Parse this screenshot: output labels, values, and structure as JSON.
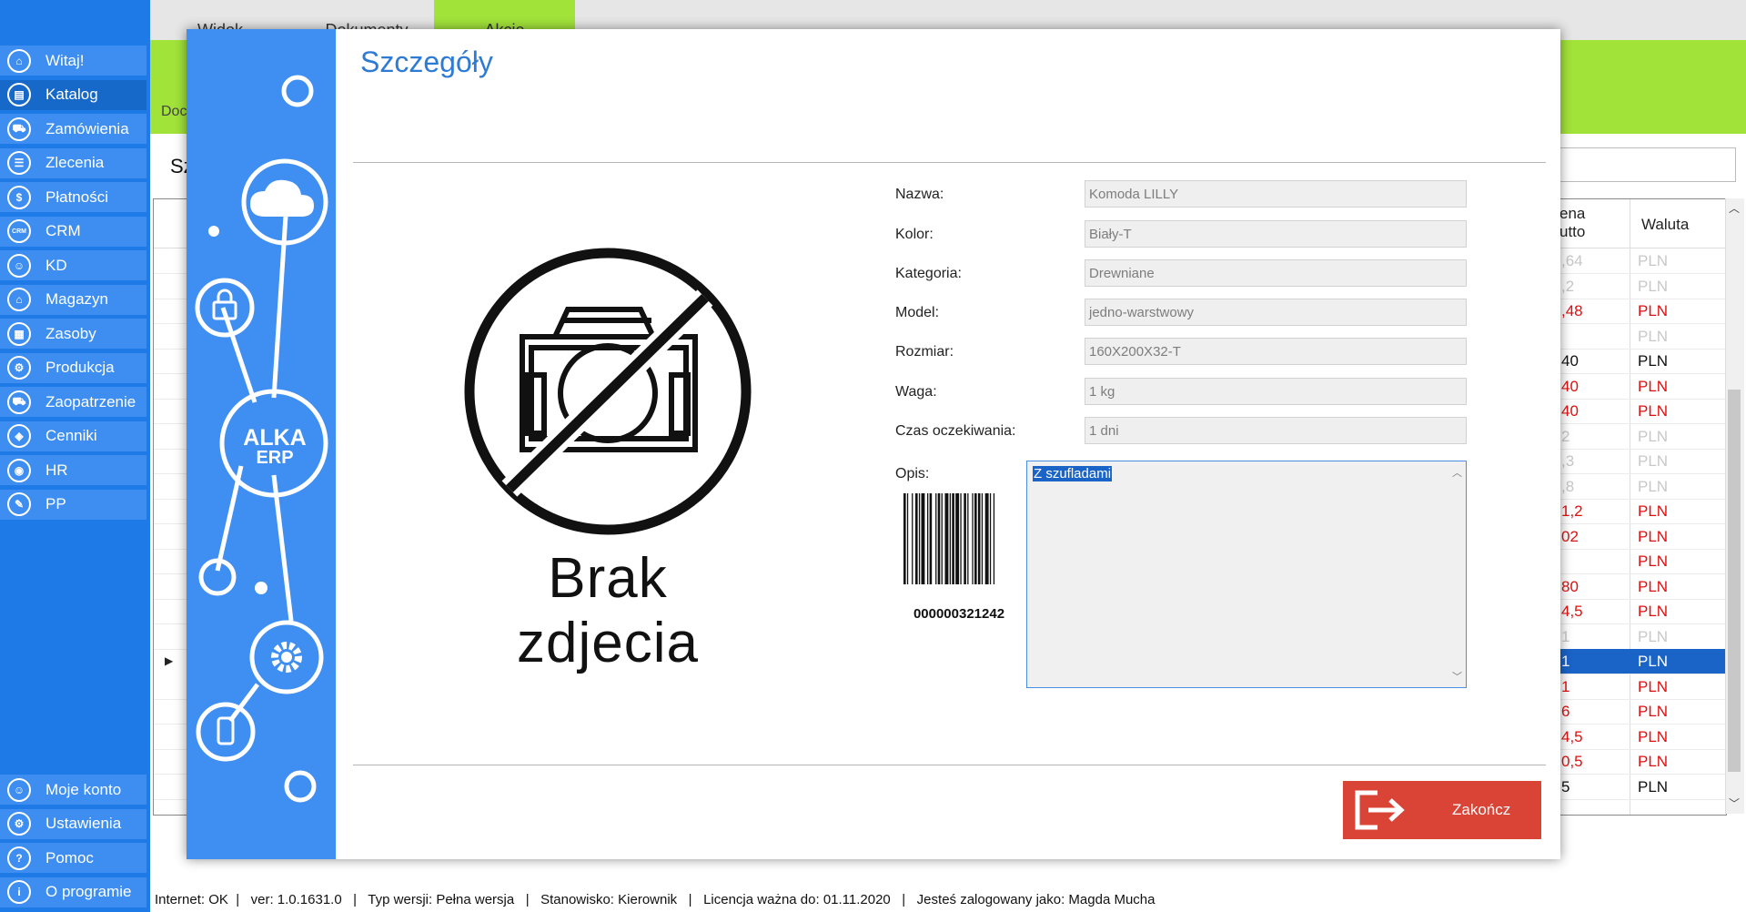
{
  "sidebar": {
    "items": [
      {
        "label": "Witaj!",
        "icon": "home-icon",
        "glyph": "⌂"
      },
      {
        "label": "Katalog",
        "icon": "book-icon",
        "glyph": "▤"
      },
      {
        "label": "Zamówienia",
        "icon": "cart-icon",
        "glyph": "⛟"
      },
      {
        "label": "Zlecenia",
        "icon": "list-icon",
        "glyph": "☰"
      },
      {
        "label": "Płatności",
        "icon": "dollar-icon",
        "glyph": "$"
      },
      {
        "label": "CRM",
        "icon": "crm-icon",
        "glyph": "CRM"
      },
      {
        "label": "KD",
        "icon": "person-icon",
        "glyph": "☺"
      },
      {
        "label": "Magazyn",
        "icon": "warehouse-icon",
        "glyph": "⌂"
      },
      {
        "label": "Zasoby",
        "icon": "resources-icon",
        "glyph": "▦"
      },
      {
        "label": "Produkcja",
        "icon": "production-icon",
        "glyph": "⚙"
      },
      {
        "label": "Zaopatrzenie",
        "icon": "truck-icon",
        "glyph": "⛟"
      },
      {
        "label": "Cenniki",
        "icon": "tag-icon",
        "glyph": "◈"
      },
      {
        "label": "HR",
        "icon": "hr-icon",
        "glyph": "◉"
      },
      {
        "label": "PP",
        "icon": "pp-icon",
        "glyph": "✎"
      }
    ],
    "bottom_items": [
      {
        "label": "Moje konto",
        "icon": "account-icon",
        "glyph": "☺"
      },
      {
        "label": "Ustawienia",
        "icon": "gear-icon",
        "glyph": "⚙"
      },
      {
        "label": "Pomoc",
        "icon": "help-icon",
        "glyph": "?"
      },
      {
        "label": "O programie",
        "icon": "info-icon",
        "glyph": "i"
      }
    ]
  },
  "topbar": {
    "tabs": [
      {
        "label": "Widok"
      },
      {
        "label": "Dokumenty"
      },
      {
        "label": "Akcje"
      }
    ]
  },
  "background": {
    "doc_label": "Doc",
    "s_label": "Sz",
    "columns": [
      "ena\nutto",
      "Waluta"
    ],
    "rows": [
      {
        "price": ",64",
        "currency": "PLN",
        "style": "grey"
      },
      {
        "price": ",2",
        "currency": "PLN",
        "style": "grey"
      },
      {
        "price": ",48",
        "currency": "PLN",
        "style": "red"
      },
      {
        "price": "",
        "currency": "PLN",
        "style": "grey"
      },
      {
        "price": "40",
        "currency": "PLN",
        "style": "black"
      },
      {
        "price": "40",
        "currency": "PLN",
        "style": "red"
      },
      {
        "price": "40",
        "currency": "PLN",
        "style": "red"
      },
      {
        "price": "2",
        "currency": "PLN",
        "style": "grey"
      },
      {
        "price": ",3",
        "currency": "PLN",
        "style": "grey"
      },
      {
        "price": ",8",
        "currency": "PLN",
        "style": "grey"
      },
      {
        "price": "1,2",
        "currency": "PLN",
        "style": "red"
      },
      {
        "price": "02",
        "currency": "PLN",
        "style": "red"
      },
      {
        "price": "",
        "currency": "PLN",
        "style": "red"
      },
      {
        "price": "80",
        "currency": "PLN",
        "style": "red"
      },
      {
        "price": "4,5",
        "currency": "PLN",
        "style": "red"
      },
      {
        "price": "1",
        "currency": "PLN",
        "style": "grey"
      },
      {
        "price": "1",
        "currency": "PLN",
        "style": "selected"
      },
      {
        "price": "1",
        "currency": "PLN",
        "style": "red"
      },
      {
        "price": "6",
        "currency": "PLN",
        "style": "red"
      },
      {
        "price": "4,5",
        "currency": "PLN",
        "style": "red"
      },
      {
        "price": "0,5",
        "currency": "PLN",
        "style": "red"
      },
      {
        "price": "5",
        "currency": "PLN",
        "style": "black"
      }
    ]
  },
  "dialog": {
    "title": "Szczegóły",
    "logo_line1": "ALKA",
    "logo_line2": "ERP",
    "no_photo_text": "Brak zdjecia",
    "barcode_number": "000000321242",
    "fields": [
      {
        "label": "Nazwa:",
        "value": "Komoda LILLY"
      },
      {
        "label": "Kolor:",
        "value": "Biały-T"
      },
      {
        "label": "Kategoria:",
        "value": "Drewniane"
      },
      {
        "label": "Model:",
        "value": "jedno-warstwowy"
      },
      {
        "label": "Rozmiar:",
        "value": "160X200X32-T"
      },
      {
        "label": "Waga:",
        "value": "1 kg"
      },
      {
        "label": "Czas oczekiwania:",
        "value": "1 dni"
      }
    ],
    "opis_label": "Opis:",
    "opis_value": "Z szufladami",
    "close_button": "Zakończ"
  },
  "statusbar": {
    "text": "Internet: OK  |   ver: 1.0.1631.0   |   Typ wersji: Pełna wersja   |   Stanowisko: Kierownik   |   Licencja ważna do: 01.11.2020   |   Jesteś zalogowany jako: Magda Mucha"
  },
  "colors": {
    "sidebar": "#1e7ae6",
    "accent_green": "#a2e33a",
    "title_blue": "#2e7bd6",
    "close_red": "#d94437",
    "price_red": "#e01010"
  }
}
